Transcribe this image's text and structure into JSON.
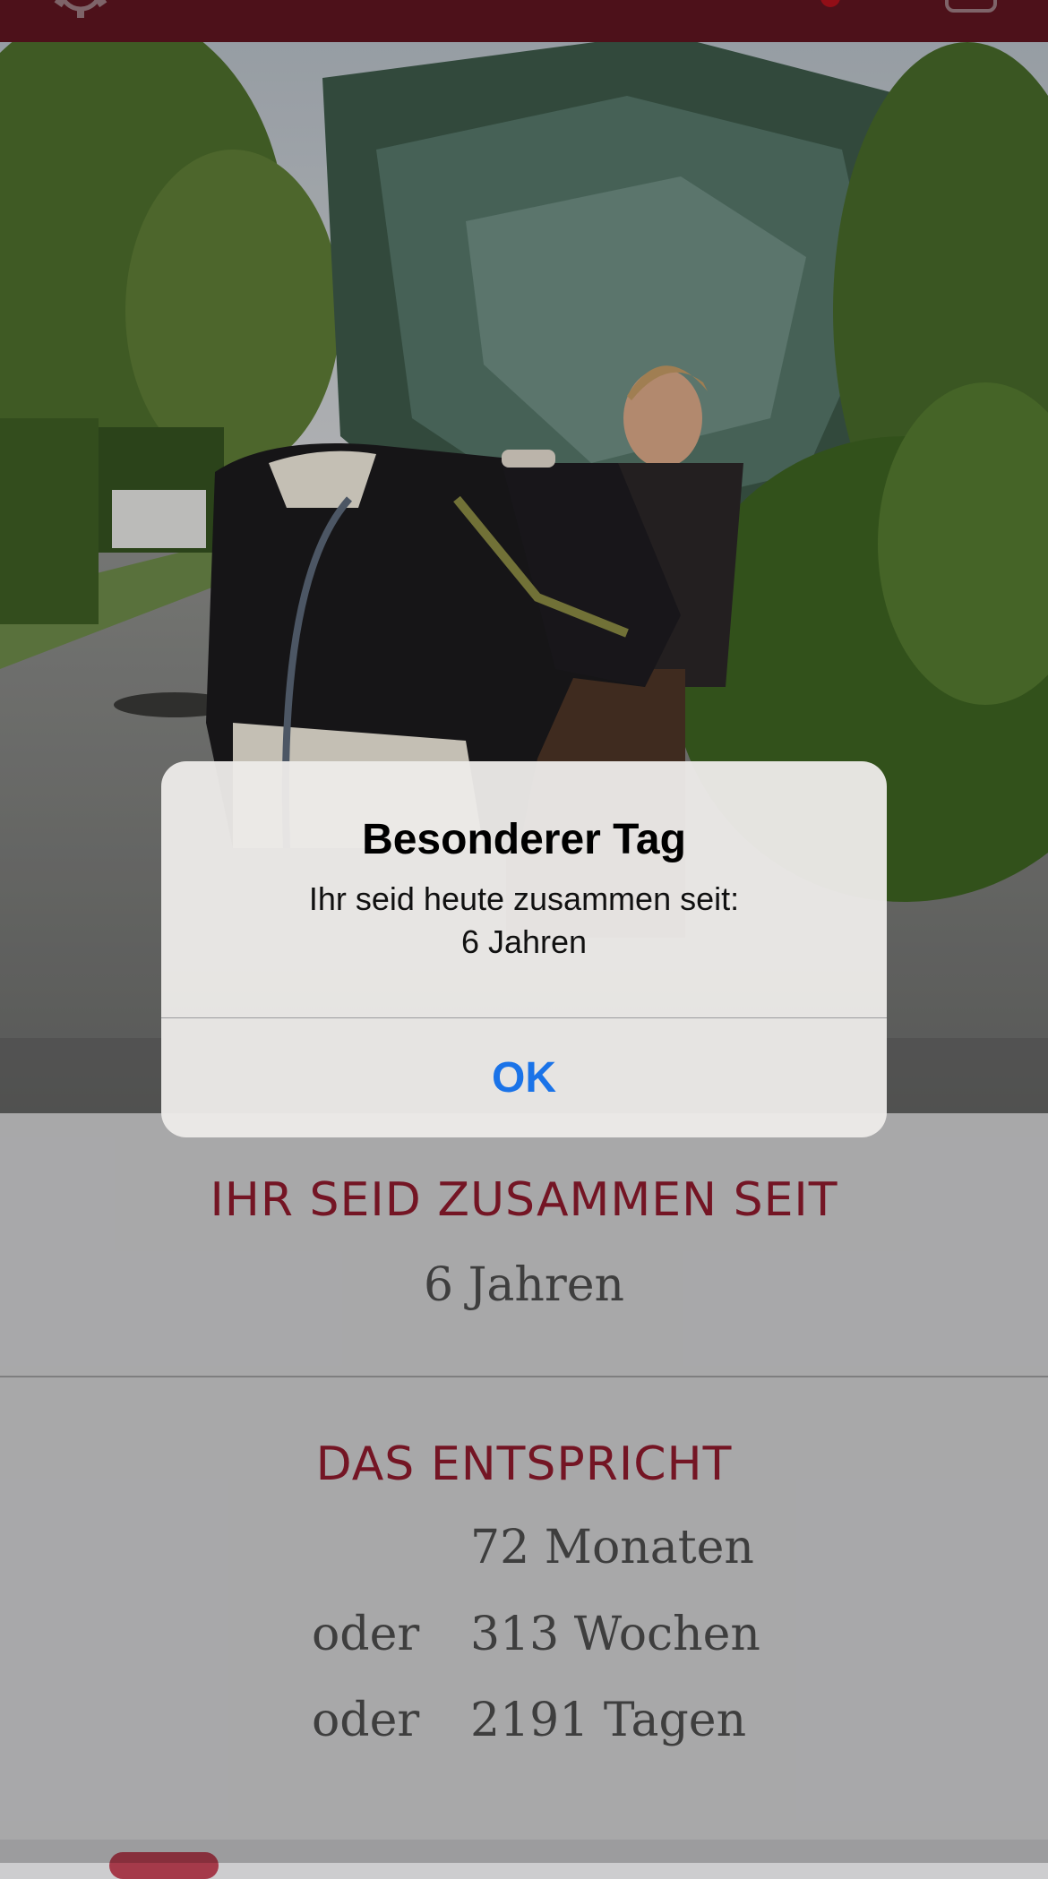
{
  "header": {
    "title_fragment": "",
    "icons": [
      "gear-icon",
      "heart-icon",
      "square-icon"
    ]
  },
  "photo": {
    "subject": "woman-with-cow"
  },
  "together": {
    "heading": "IHR SEID ZUSAMMEN SEIT",
    "value": "6 Jahren"
  },
  "equivalent": {
    "heading": "DAS ENTSPRICHT",
    "rows": [
      {
        "prefix": "",
        "value": "72 Monaten"
      },
      {
        "prefix": "oder",
        "value": "313 Wochen"
      },
      {
        "prefix": "oder",
        "value": "2191 Tagen"
      }
    ]
  },
  "alert": {
    "title": "Besonderer Tag",
    "message_line1": "Ihr seid heute zusammen seit:",
    "message_line2": "6 Jahren",
    "ok_label": "OK"
  },
  "colors": {
    "header_bg": "#5e1520",
    "accent": "#8e1a2c",
    "alert_button": "#1a73e8"
  }
}
